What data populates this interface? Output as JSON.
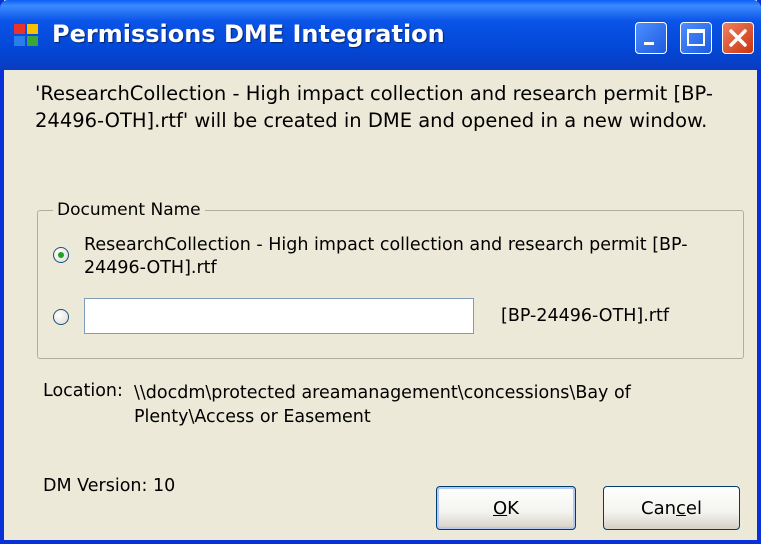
{
  "window": {
    "title": "Permissions DME Integration",
    "controls": [
      "minimize-icon",
      "maximize-icon",
      "close-icon"
    ]
  },
  "message": "'ResearchCollection - High impact collection and research permit [BP-24496-OTH].rtf' will be created in DME and opened in a new window.",
  "document_name": {
    "label": "Document Name",
    "option1": {
      "text": "ResearchCollection - High impact collection and research permit [BP-24496-OTH].rtf",
      "selected": true
    },
    "option2": {
      "input_value": "",
      "suffix": "[BP-24496-OTH].rtf",
      "selected": false
    }
  },
  "location": {
    "label": "Location:",
    "path": "\\\\docdm\\protected areamanagement\\concessions\\Bay of Plenty\\Access or Easement"
  },
  "dm_version": "DM Version: 10",
  "buttons": {
    "ok": {
      "pre": "",
      "accel": "O",
      "post": "K"
    },
    "cancel": {
      "pre": "Can",
      "accel": "c",
      "post": "el"
    }
  },
  "colors": {
    "titlebar": "#0a54e8",
    "window_bg": "#ece9d8",
    "close_button": "#c8350d"
  }
}
